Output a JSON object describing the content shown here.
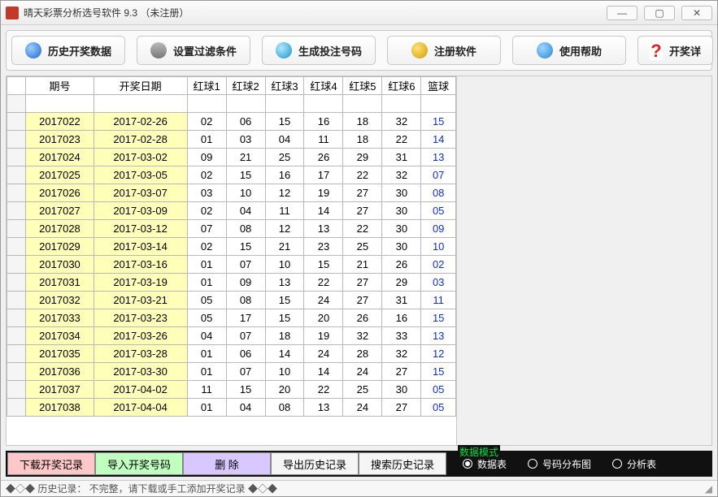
{
  "window": {
    "title": "晴天彩票分析选号软件 9.3 （未注册）"
  },
  "toolbar": {
    "history": "历史开奖数据",
    "filter": "设置过滤条件",
    "generate": "生成投注号码",
    "register": "注册软件",
    "help": "使用帮助",
    "detail": "开奖详"
  },
  "table": {
    "headers": {
      "issue": "期号",
      "date": "开奖日期",
      "r1": "红球1",
      "r2": "红球2",
      "r3": "红球3",
      "r4": "红球4",
      "r5": "红球5",
      "r6": "红球6",
      "blue": "篮球"
    },
    "rows": [
      {
        "issue": "2017022",
        "date": "2017-02-26",
        "r": [
          "02",
          "06",
          "15",
          "16",
          "18",
          "32"
        ],
        "b": "15"
      },
      {
        "issue": "2017023",
        "date": "2017-02-28",
        "r": [
          "01",
          "03",
          "04",
          "11",
          "18",
          "22"
        ],
        "b": "14"
      },
      {
        "issue": "2017024",
        "date": "2017-03-02",
        "r": [
          "09",
          "21",
          "25",
          "26",
          "29",
          "31"
        ],
        "b": "13"
      },
      {
        "issue": "2017025",
        "date": "2017-03-05",
        "r": [
          "02",
          "15",
          "16",
          "17",
          "22",
          "32"
        ],
        "b": "07"
      },
      {
        "issue": "2017026",
        "date": "2017-03-07",
        "r": [
          "03",
          "10",
          "12",
          "19",
          "27",
          "30"
        ],
        "b": "08"
      },
      {
        "issue": "2017027",
        "date": "2017-03-09",
        "r": [
          "02",
          "04",
          "11",
          "14",
          "27",
          "30"
        ],
        "b": "05"
      },
      {
        "issue": "2017028",
        "date": "2017-03-12",
        "r": [
          "07",
          "08",
          "12",
          "13",
          "22",
          "30"
        ],
        "b": "09"
      },
      {
        "issue": "2017029",
        "date": "2017-03-14",
        "r": [
          "02",
          "15",
          "21",
          "23",
          "25",
          "30"
        ],
        "b": "10"
      },
      {
        "issue": "2017030",
        "date": "2017-03-16",
        "r": [
          "01",
          "07",
          "10",
          "15",
          "21",
          "26"
        ],
        "b": "02"
      },
      {
        "issue": "2017031",
        "date": "2017-03-19",
        "r": [
          "01",
          "09",
          "13",
          "22",
          "27",
          "29"
        ],
        "b": "03"
      },
      {
        "issue": "2017032",
        "date": "2017-03-21",
        "r": [
          "05",
          "08",
          "15",
          "24",
          "27",
          "31"
        ],
        "b": "11"
      },
      {
        "issue": "2017033",
        "date": "2017-03-23",
        "r": [
          "05",
          "17",
          "15",
          "20",
          "26",
          "16"
        ],
        "b": "15"
      },
      {
        "issue": "2017034",
        "date": "2017-03-26",
        "r": [
          "04",
          "07",
          "18",
          "19",
          "32",
          "33"
        ],
        "b": "13"
      },
      {
        "issue": "2017035",
        "date": "2017-03-28",
        "r": [
          "01",
          "06",
          "14",
          "24",
          "28",
          "32"
        ],
        "b": "12"
      },
      {
        "issue": "2017036",
        "date": "2017-03-30",
        "r": [
          "01",
          "07",
          "10",
          "14",
          "24",
          "27"
        ],
        "b": "15"
      },
      {
        "issue": "2017037",
        "date": "2017-04-02",
        "r": [
          "11",
          "15",
          "20",
          "22",
          "25",
          "30"
        ],
        "b": "05"
      },
      {
        "issue": "2017038",
        "date": "2017-04-04",
        "r": [
          "01",
          "04",
          "08",
          "13",
          "24",
          "27"
        ],
        "b": "05"
      }
    ]
  },
  "bottom_tabs": {
    "download": "下载开奖记录",
    "import": "导入开奖号码",
    "delete": "删 除",
    "export": "导出历史记录",
    "search": "搜索历史记录"
  },
  "mode_group": {
    "legend": "数据模式",
    "opt1": "数据表",
    "opt2": "号码分布图",
    "opt3": "分析表"
  },
  "status": {
    "text": "◆◇◆  历史记录：  不完整，请下载或手工添加开奖记录  ◆◇◆"
  }
}
